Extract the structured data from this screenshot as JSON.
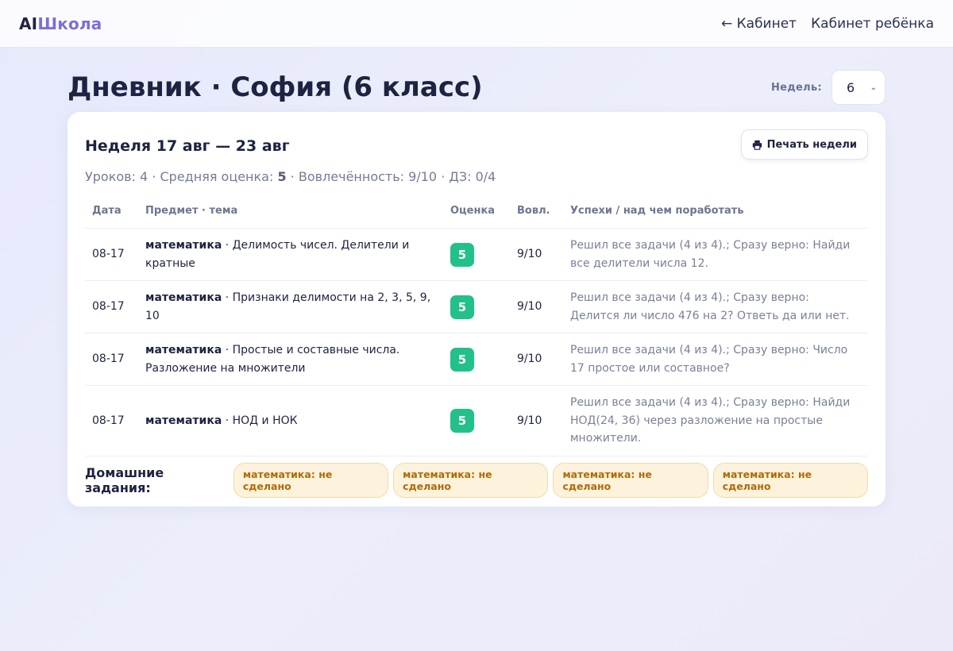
{
  "topbar": {
    "logo_part1": "AI",
    "logo_part2": "Школа",
    "nav_cabinet": "← Кабинет",
    "nav_child_cabinet": "Кабинет ребёнка"
  },
  "header": {
    "title": "Дневник · София (6 класс)",
    "weeks_label": "Недель:",
    "weeks_value": "6"
  },
  "card": {
    "week_title": "Неделя 17 авг — 23 авг",
    "print_label": "Печать недели",
    "summary": {
      "lessons": "Уроков: 4 · Средняя оценка: ",
      "avg_grade": "5",
      "rest": " · Вовлечённость: 9/10 · ДЗ: 0/4"
    },
    "columns": [
      "Дата",
      "Предмет · тема",
      "Оценка",
      "Вовл.",
      "Успехи / над чем поработать"
    ],
    "rows": [
      {
        "date": "08-17",
        "subject": "математика",
        "topic": " · Делимость чисел. Делители и кратные",
        "grade": "5",
        "engagement": "9/10",
        "notes": "Решил все задачи (4 из 4).; Сразу верно: Найди все делители числа 12."
      },
      {
        "date": "08-17",
        "subject": "математика",
        "topic": " · Признаки делимости на 2, 3, 5, 9, 10",
        "grade": "5",
        "engagement": "9/10",
        "notes": "Решил все задачи (4 из 4).; Сразу верно: Делится ли число 476 на 2? Ответь да или нет."
      },
      {
        "date": "08-17",
        "subject": "математика",
        "topic": " · Простые и составные числа. Разложение на множители",
        "grade": "5",
        "engagement": "9/10",
        "notes": "Решил все задачи (4 из 4).; Сразу верно: Число 17 простое или составное?"
      },
      {
        "date": "08-17",
        "subject": "математика",
        "topic": " · НОД и НОК",
        "grade": "5",
        "engagement": "9/10",
        "notes": "Решил все задачи (4 из 4).; Сразу верно: Найди НОД(24, 36) через разложение на простые множители."
      }
    ],
    "homework_label": "Домашние задания:",
    "homework": [
      "математика: не сделано",
      "математика: не сделано",
      "математика: не сделано",
      "математика: не сделано"
    ]
  }
}
